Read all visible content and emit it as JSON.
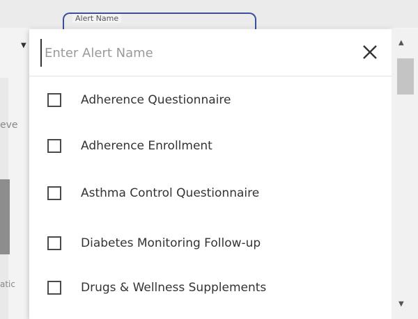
{
  "alert_field": {
    "label": "Alert Name"
  },
  "background": {
    "left_text_1": "eve",
    "left_text_2": "atic"
  },
  "search": {
    "placeholder": "Enter Alert Name",
    "value": ""
  },
  "options": [
    {
      "label": "Adherence Questionnaire",
      "checked": false
    },
    {
      "label": "Adherence Enrollment",
      "checked": false
    },
    {
      "label": "Asthma Control Questionnaire",
      "checked": false
    },
    {
      "label": "Diabetes Monitoring Follow-up",
      "checked": false
    },
    {
      "label": "Drugs & Wellness Supplements",
      "checked": false
    }
  ],
  "icons": {
    "close": "close-icon",
    "checkbox": "checkbox-icon",
    "scroll_up": "chevron-up-icon",
    "scroll_down": "chevron-down-icon"
  }
}
